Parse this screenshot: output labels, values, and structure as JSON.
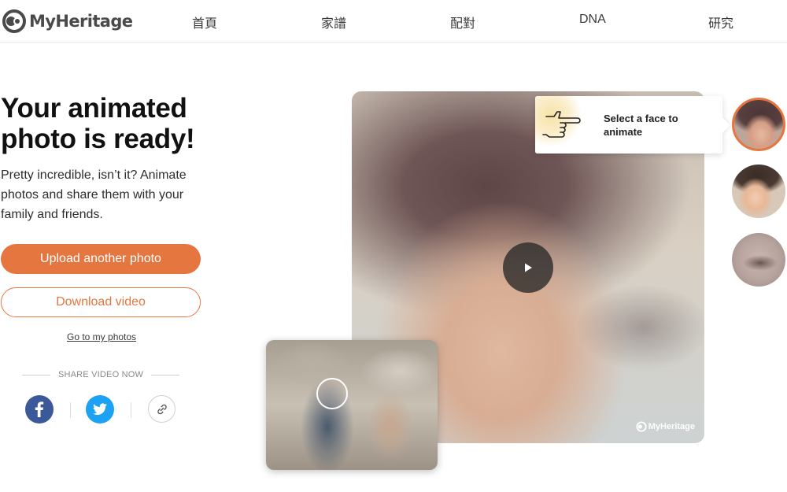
{
  "brand": {
    "name": "MyHeritage",
    "accent_color": "#e5763f",
    "logo_icon": "myheritage-logo-icon"
  },
  "nav": {
    "items": [
      {
        "label": "首頁"
      },
      {
        "label": "家譜"
      },
      {
        "label": "配對"
      },
      {
        "label": "DNA"
      },
      {
        "label": "研究"
      }
    ]
  },
  "hero": {
    "title": "Your animated photo is ready!",
    "description": "Pretty incredible, isn’t it? Animate photos and share them with your family and friends."
  },
  "actions": {
    "upload_label": "Upload another photo",
    "download_label": "Download video",
    "my_photos_label": "Go to my photos"
  },
  "share": {
    "label": "SHARE VIDEO NOW",
    "icons": [
      "facebook-icon",
      "twitter-icon",
      "link-icon"
    ]
  },
  "viewer": {
    "play_icon": "play-icon",
    "watermark": "MyHeritage"
  },
  "face_select": {
    "tooltip": "Select a face to animate",
    "faces": [
      {
        "selected": true
      },
      {
        "selected": false
      },
      {
        "selected": false
      }
    ]
  }
}
